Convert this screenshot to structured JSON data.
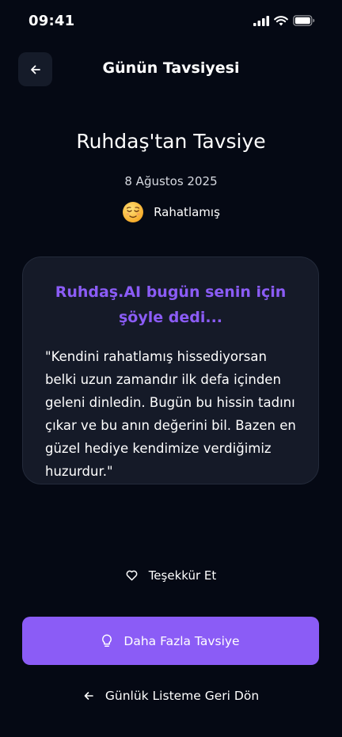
{
  "status_bar": {
    "time": "09:41"
  },
  "header": {
    "title": "Günün Tavsiyesi",
    "back_icon": "arrow-left-icon"
  },
  "hero": {
    "title": "Ruhdaş'tan Tavsiye",
    "date": "8 Ağustos 2025",
    "mood": {
      "emoji_icon": "relieved-face-icon",
      "label": "Rahatlamış"
    }
  },
  "card": {
    "heading": "Ruhdaş.AI bugün senin için şöyle dedi...",
    "quote": "\"Kendini rahatlamış hissediyorsan belki uzun zamandır ilk defa içinden geleni dinledin. Bugün bu hissin tadını çıkar ve bu anın değerini bil. Bazen en güzel hediye kendimize verdiğimiz huzurdur.\""
  },
  "actions": {
    "thanks_label": "Teşekkür Et",
    "thanks_icon": "heart-icon",
    "more_label": "Daha Fazla Tavsiye",
    "more_icon": "lightbulb-icon",
    "return_label": "Günlük Listeme Geri Dön",
    "return_icon": "arrow-left-icon"
  },
  "colors": {
    "background": "#050914",
    "card": "#151a28",
    "accent": "#8b5cf6",
    "back_button": "#151b29"
  }
}
